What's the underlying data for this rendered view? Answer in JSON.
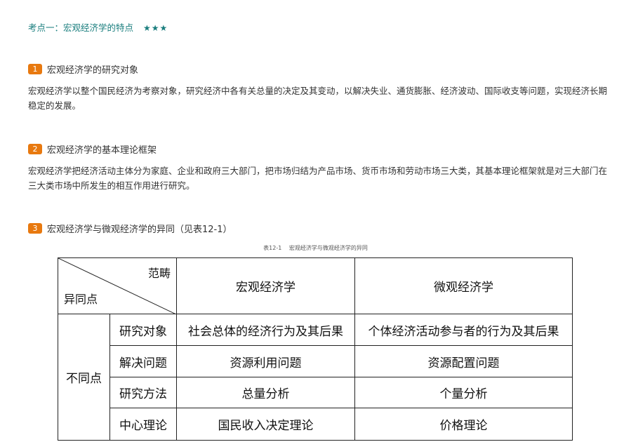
{
  "kaodian": {
    "title": "考点一：宏观经济学的特点",
    "stars": "★★★"
  },
  "sections": [
    {
      "num": "1",
      "title": "宏观经济学的研究对象",
      "body": "宏观经济学以整个国民经济为考察对象，研究经济中各有关总量的决定及其变动，以解决失业、通货膨胀、经济波动、国际收支等问题，实现经济长期稳定的发展。"
    },
    {
      "num": "2",
      "title": "宏观经济学的基本理论框架",
      "body": "宏观经济学把经济活动主体分为家庭、企业和政府三大部门，把市场归结为产品市场、货币市场和劳动市场三大类，其基本理论框架就是对三大部门在三大类市场中所发生的相互作用进行研究。"
    },
    {
      "num": "3",
      "title": "宏观经济学与微观经济学的异同（见表12-1）"
    }
  ],
  "table": {
    "caption_num": "表12-1",
    "caption_title": "宏观经济学与微观经济学的异同",
    "corner_top": "范畴",
    "corner_bottom": "异同点",
    "col_macro": "宏观经济学",
    "col_micro": "微观经济学",
    "group_label": "不同点",
    "rows": [
      {
        "label": "研究对象",
        "macro": "社会总体的经济行为及其后果",
        "micro": "个体经济活动参与者的行为及其后果"
      },
      {
        "label": "解决问题",
        "macro": "资源利用问题",
        "micro": "资源配置问题"
      },
      {
        "label": "研究方法",
        "macro": "总量分析",
        "micro": "个量分析"
      },
      {
        "label": "中心理论",
        "macro": "国民收入决定理论",
        "micro": "价格理论"
      }
    ]
  }
}
